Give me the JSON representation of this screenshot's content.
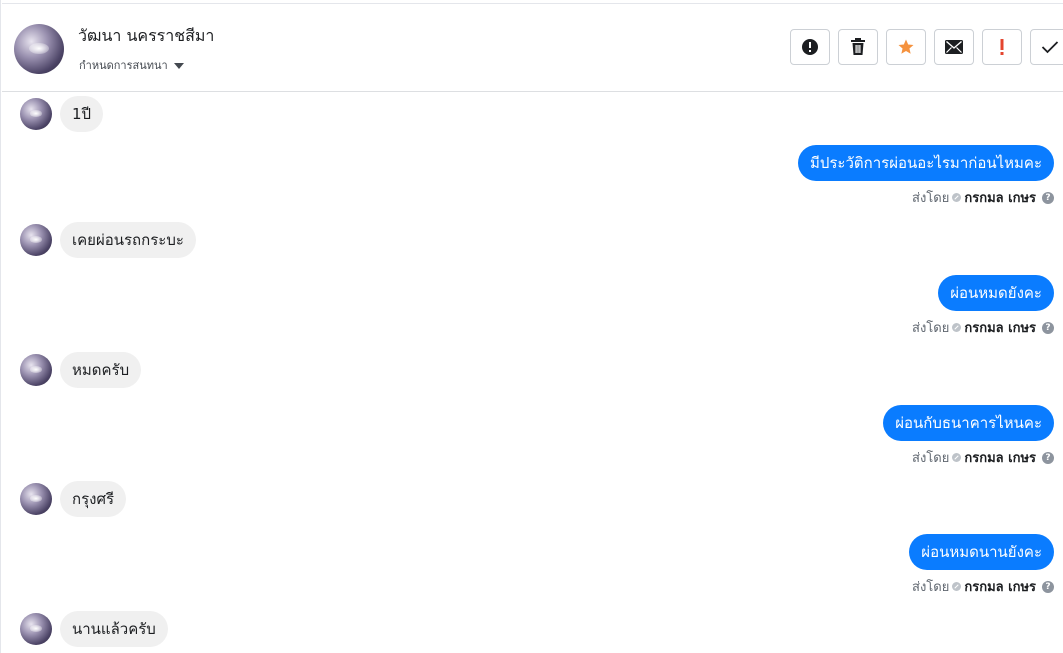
{
  "header": {
    "contact_name": "วัฒนา นครราชสีมา",
    "assign_label": "กำหนดการสนทนา"
  },
  "toolbar": {
    "buttons": [
      {
        "icon": "alert-circle-icon",
        "color": "#1c1e21"
      },
      {
        "icon": "trash-icon",
        "color": "#1c1e21"
      },
      {
        "icon": "star-icon",
        "color": "#f5923e"
      },
      {
        "icon": "envelope-icon",
        "color": "#1c1e21"
      },
      {
        "icon": "exclamation-icon",
        "color": "#e4452f"
      },
      {
        "icon": "check-icon",
        "color": "#1c1e21"
      }
    ]
  },
  "colors": {
    "outgoing_bubble": "#0a7cff",
    "incoming_bubble": "#f0f0f0"
  },
  "messages": {
    "in_1": "1ปี",
    "out_1": "มีประวัติการผ่อนอะไรมาก่อนไหมคะ",
    "in_2": "เคยผ่อนรถกระบะ",
    "out_2": "ผ่อนหมดยังคะ",
    "in_3": "หมดครับ",
    "out_3": "ผ่อนกับธนาคารไหนคะ",
    "in_4": "กรุงศรี",
    "out_4": "ผ่อนหมดนานยังคะ",
    "in_5": "นานแล้วครับ"
  },
  "sent_by": {
    "label": "ส่งโดย",
    "agent": "กรกมล เกษร",
    "help": "?"
  }
}
